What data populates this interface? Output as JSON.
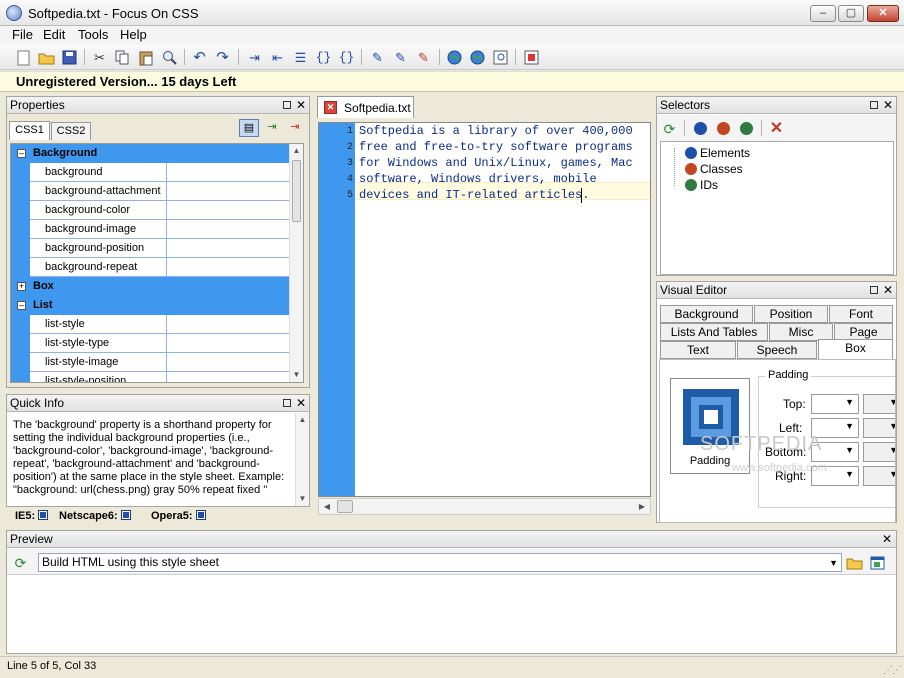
{
  "window": {
    "title": "Softpedia.txt - Focus On CSS",
    "controls": {
      "minimize": "–",
      "maximize": "▢",
      "close": "✕"
    }
  },
  "menu": [
    "File",
    "Edit",
    "Tools",
    "Help"
  ],
  "toolbar": {
    "icons": [
      "new-file-icon",
      "open-folder-icon",
      "save-icon",
      "cut-icon",
      "copy-icon",
      "paste-icon",
      "find-icon",
      "undo-icon",
      "redo-icon",
      "indent-icon",
      "outdent-icon",
      "list-icon",
      "braces-icon",
      "format-braces-icon",
      "css-check-icon",
      "css-validate-icon",
      "css-remove-icon",
      "globe-icon",
      "globe-refresh-icon",
      "preview-page-icon",
      "checklist-icon"
    ]
  },
  "banner": {
    "text": "Unregistered Version...  15 days Left"
  },
  "properties": {
    "title": "Properties",
    "tabs": [
      "CSS1",
      "CSS2"
    ],
    "active_tab": "CSS1",
    "rows": [
      {
        "type": "category",
        "label": "Background",
        "expanded": true
      },
      {
        "type": "prop",
        "label": "background"
      },
      {
        "type": "prop",
        "label": "background-attachment"
      },
      {
        "type": "prop",
        "label": "background-color"
      },
      {
        "type": "prop",
        "label": "background-image"
      },
      {
        "type": "prop",
        "label": "background-position"
      },
      {
        "type": "prop",
        "label": "background-repeat"
      },
      {
        "type": "category",
        "label": "Box",
        "expanded": false
      },
      {
        "type": "category",
        "label": "List",
        "expanded": true
      },
      {
        "type": "prop",
        "label": "list-style"
      },
      {
        "type": "prop",
        "label": "list-style-type"
      },
      {
        "type": "prop",
        "label": "list-style-image"
      },
      {
        "type": "prop",
        "label": "list-style-position"
      }
    ]
  },
  "quick_info": {
    "title": "Quick Info",
    "text": "The 'background' property is a shorthand property for setting the individual background properties (i.e., 'background-color', 'background-image', 'background-repeat', 'background-attachment' and 'background-position') at the same place in the style sheet. Example: \"background: url(chess.png) gray 50% repeat fixed \""
  },
  "browsers": [
    {
      "label": "IE5:"
    },
    {
      "label": "Netscape6:"
    },
    {
      "label": "Opera5:"
    }
  ],
  "editor": {
    "tab_label": "Softpedia.txt",
    "lines": [
      "Softpedia is a library of over 400,000",
      "free and free-to-try software programs",
      "for Windows and Unix/Linux, games, Mac",
      "software, Windows drivers, mobile",
      "devices and IT-related articles."
    ],
    "line_numbers": [
      "1",
      "2",
      "3",
      "4",
      "5"
    ]
  },
  "selectors": {
    "title": "Selectors",
    "tree": [
      {
        "label": "Elements",
        "color": "#1f4fa8"
      },
      {
        "label": "Classes",
        "color": "#c2461f"
      },
      {
        "label": "IDs",
        "color": "#2f7a3e"
      }
    ]
  },
  "visual_editor": {
    "title": "Visual Editor",
    "tabs_row1": [
      "Background",
      "Position",
      "Font"
    ],
    "tabs_row2": [
      "Lists And Tables",
      "Misc",
      "Page"
    ],
    "tabs_row3": [
      "Text",
      "Speech",
      "Box"
    ],
    "active_tab": "Box",
    "box_caption": "Padding",
    "group_title": "Padding",
    "fields": [
      "Top:",
      "Left:",
      "Bottom:",
      "Right:"
    ]
  },
  "preview": {
    "title": "Preview",
    "select_value": "Build HTML using this style sheet"
  },
  "status": {
    "text": "Line 5 of  5, Col 33"
  },
  "watermark": {
    "main": "SOFTPEDIA",
    "sub": "www.softpedia.com"
  }
}
